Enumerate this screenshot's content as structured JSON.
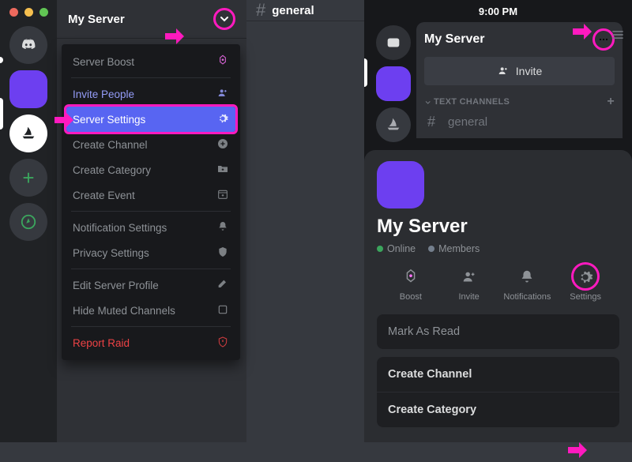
{
  "desktop": {
    "server_name": "My Server",
    "channel_name": "general",
    "menu": {
      "boost": "Server Boost",
      "invite": "Invite People",
      "settings": "Server Settings",
      "create_channel": "Create Channel",
      "create_category": "Create Category",
      "create_event": "Create Event",
      "notifications": "Notification Settings",
      "privacy": "Privacy Settings",
      "edit_profile": "Edit Server Profile",
      "hide_muted": "Hide Muted Channels",
      "report_raid": "Report Raid"
    }
  },
  "mobile": {
    "time": "9:00 PM",
    "server_name": "My Server",
    "invite_button": "Invite",
    "category": "TEXT CHANNELS",
    "channel": "general",
    "sheet": {
      "title": "My Server",
      "online": "Online",
      "members": "Members",
      "actions": {
        "boost": "Boost",
        "invite": "Invite",
        "notifications": "Notifications",
        "settings": "Settings"
      },
      "list": {
        "mark_read": "Mark As Read",
        "create_channel": "Create Channel",
        "create_category": "Create Category"
      }
    }
  }
}
